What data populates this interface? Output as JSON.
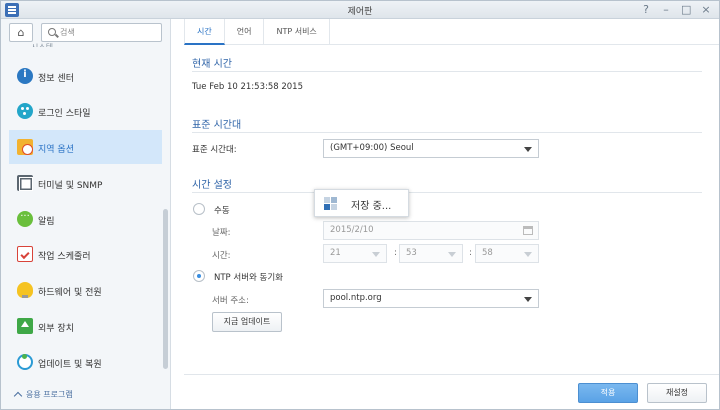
{
  "window": {
    "title": "제어판",
    "controls": [
      "?",
      "–",
      "□",
      "×"
    ]
  },
  "sidebar": {
    "search_placeholder": "검색",
    "cut_label": "시스템",
    "items": [
      {
        "label": "정보 센터",
        "icon": "info-icon"
      },
      {
        "label": "로그인 스타일",
        "icon": "palette-icon"
      },
      {
        "label": "지역 옵션",
        "icon": "region-icon",
        "active": true
      },
      {
        "label": "터미널 및 SNMP",
        "icon": "terminal-icon"
      },
      {
        "label": "알림",
        "icon": "notification-icon"
      },
      {
        "label": "작업 스케줄러",
        "icon": "scheduler-icon"
      },
      {
        "label": "하드웨어 및 전원",
        "icon": "bulb-icon"
      },
      {
        "label": "외부 장치",
        "icon": "external-device-icon"
      },
      {
        "label": "업데이트 및 복원",
        "icon": "update-icon"
      }
    ],
    "apps_label": "응용 프로그램"
  },
  "tabs": [
    "시간",
    "언어",
    "NTP 서비스"
  ],
  "current_time": {
    "title": "현재 시간",
    "value": "Tue Feb 10 21:53:58 2015"
  },
  "timezone": {
    "title": "표준 시간대",
    "label": "표준 시간대:",
    "value": "(GMT+09:00) Seoul"
  },
  "time_settings": {
    "title": "시간 설정",
    "manual_label": "수동",
    "date_label": "날짜:",
    "date_value": "2015/2/10",
    "time_label": "시간:",
    "hour": "21",
    "minute": "53",
    "second": "58",
    "separator": ":",
    "ntp_label": "NTP 서버와 동기화",
    "server_label": "서버 주소:",
    "server_value": "pool.ntp.org",
    "update_now_label": "지금 업데이트"
  },
  "saving_toast": "저장 중...",
  "footer": {
    "apply_label": "적용",
    "reset_label": "재설정"
  },
  "colors": {
    "accent": "#2a73c5",
    "active_bg": "#d3e7fa",
    "primary_button": "#5aa2e6"
  }
}
